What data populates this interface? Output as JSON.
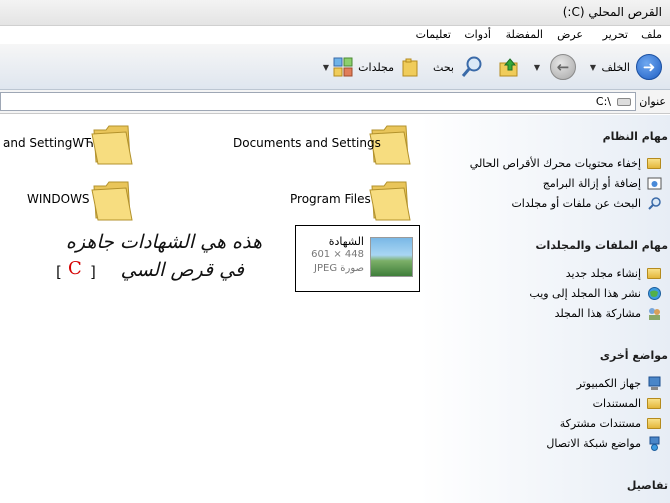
{
  "window": {
    "title": "القرص المحلي (C:)"
  },
  "menu": [
    "ملف",
    "تحرير",
    "عرض",
    "المفضلة",
    "أدوات",
    "تعليمات"
  ],
  "toolbar": {
    "back": "الخلف",
    "search": "بحث",
    "folders": "مجلدات"
  },
  "address": {
    "label": "عنوان",
    "value": "C:\\"
  },
  "taskpane": {
    "system_tasks": {
      "title": "مهام النظام",
      "items": [
        "إخفاء محتويات محرك الأقراص الحالي",
        "إضافة أو إزالة البرامج",
        "البحث عن ملفات أو مجلدات"
      ]
    },
    "file_tasks": {
      "title": "مهام الملفات والمجلدات",
      "items": [
        "إنشاء مجلد جديد",
        "نشر هذا المجلد إلى ويب",
        "مشاركة هذا المجلد"
      ]
    },
    "other_places": {
      "title": "مواضع أخرى",
      "items": [
        "جهاز الكمبيوتر",
        "المستندات",
        "مستندات مشتركة",
        "مواضع شبكة الاتصال"
      ]
    },
    "details": {
      "title": "تفاصيل"
    }
  },
  "folders": [
    "Documents and Settings",
    "and SettingWЋ",
    "Program Files",
    "WINDOWS"
  ],
  "file": {
    "name": "الشهادة",
    "dims": "601 × 448",
    "type": "JPEG صورة"
  },
  "annotation": {
    "line1": "هذه هي الشهادات جاهزه",
    "line2": "في قرص السي",
    "drive_letter": "C",
    "bracket_open": "[",
    "bracket_close": "]"
  },
  "colors": {
    "accent": "#1f5fc4",
    "annotation_drive": "#d40000"
  }
}
